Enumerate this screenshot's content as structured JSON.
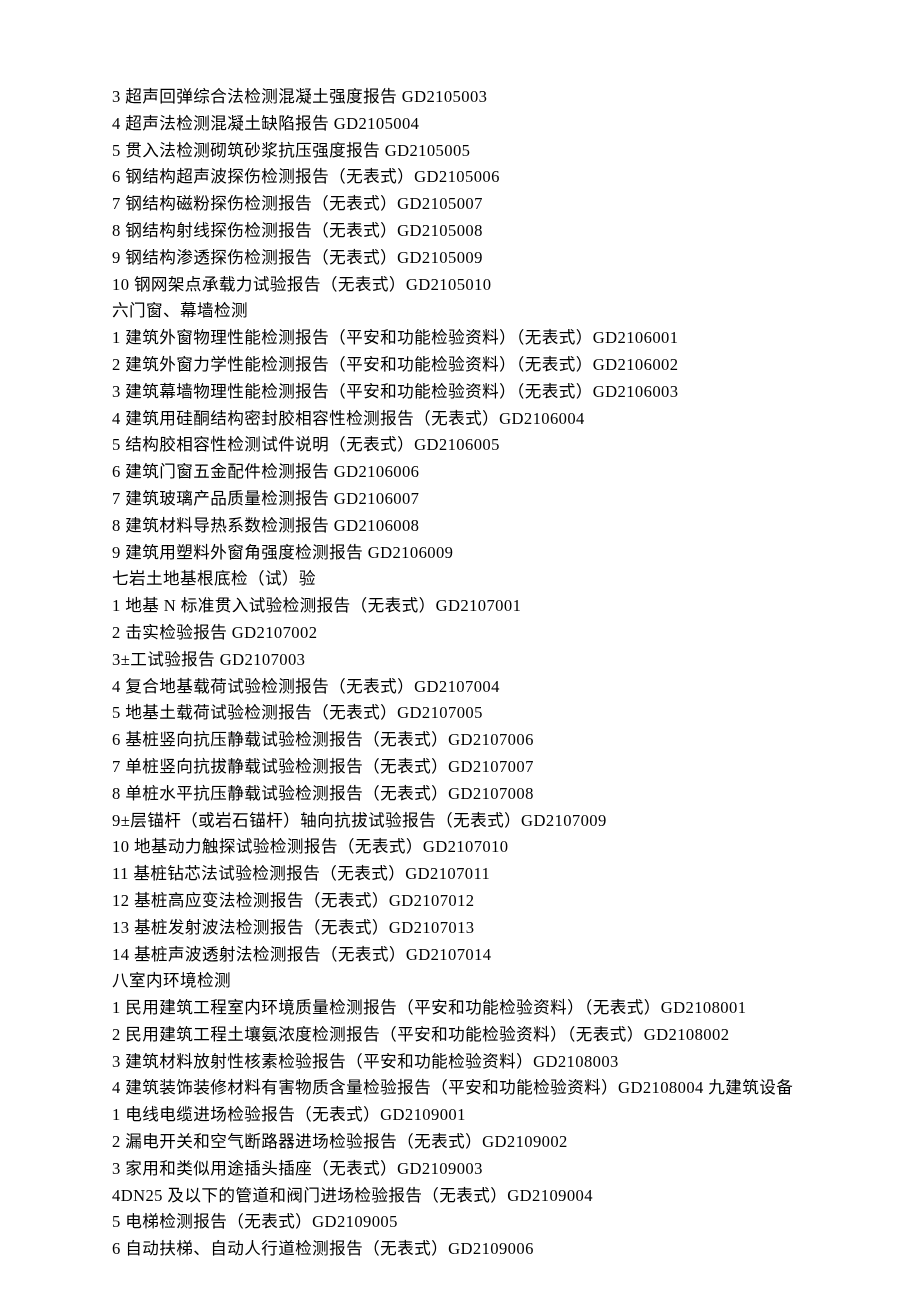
{
  "lines": [
    "3 超声回弹综合法检测混凝土强度报告 GD2105003",
    "4 超声法检测混凝土缺陷报告 GD2105004",
    "5 贯入法检测砌筑砂浆抗压强度报告 GD2105005",
    "6 钢结构超声波探伤检测报告（无表式）GD2105006",
    "7 钢结构磁粉探伤检测报告（无表式）GD2105007",
    "8 钢结构射线探伤检测报告（无表式）GD2105008",
    "9 钢结构渗透探伤检测报告（无表式）GD2105009",
    "10 钢网架点承载力试验报告（无表式）GD2105010",
    "六门窗、幕墙检测",
    "1 建筑外窗物理性能检测报告（平安和功能检验资料）（无表式）GD2106001",
    "2 建筑外窗力学性能检测报告（平安和功能检验资料）（无表式）GD2106002",
    "3 建筑幕墙物理性能检测报告（平安和功能检验资料）（无表式）GD2106003",
    "4 建筑用硅酮结构密封胶相容性检测报告（无表式）GD2106004",
    "5 结构胶相容性检测试件说明（无表式）GD2106005",
    "6 建筑门窗五金配件检测报告 GD2106006",
    "7 建筑玻璃产品质量检测报告 GD2106007",
    "8 建筑材料导热系数检测报告 GD2106008",
    "9 建筑用塑料外窗角强度检测报告 GD2106009",
    "七岩土地基根底检（试）验",
    "1 地基 N 标准贯入试验检测报告（无表式）GD2107001",
    "2 击实检验报告 GD2107002",
    "3±工试验报告 GD2107003",
    "4 复合地基载荷试验检测报告（无表式）GD2107004",
    "5 地基土载荷试验检测报告（无表式）GD2107005",
    "6 基桩竖向抗压静载试验检测报告（无表式）GD2107006",
    "7 单桩竖向抗拔静载试验检测报告（无表式）GD2107007",
    "8 单桩水平抗压静载试验检测报告（无表式）GD2107008",
    "9±层锚杆（或岩石锚杆）轴向抗拔试验报告（无表式）GD2107009",
    "10 地基动力触探试验检测报告（无表式）GD2107010",
    "11 基桩钻芯法试验检测报告（无表式）GD2107011",
    "12 基桩高应变法检测报告（无表式）GD2107012",
    "13 基桩发射波法检测报告（无表式）GD2107013",
    "14 基桩声波透射法检测报告（无表式）GD2107014",
    "八室内环境检测",
    "1 民用建筑工程室内环境质量检测报告（平安和功能检验资料）（无表式）GD2108001",
    "2 民用建筑工程土壤氨浓度检测报告（平安和功能检验资料）（无表式）GD2108002",
    "3 建筑材料放射性核素检验报告（平安和功能检验资料）GD2108003",
    "4 建筑装饰装修材料有害物质含量检验报告（平安和功能检验资料）GD2108004 九建筑设备",
    "1 电线电缆进场检验报告（无表式）GD2109001",
    "2 漏电开关和空气断路器进场检验报告（无表式）GD2109002",
    "3 家用和类似用途插头插座（无表式）GD2109003",
    "4DN25 及以下的管道和阀门进场检验报告（无表式）GD2109004",
    "5 电梯检测报告（无表式）GD2109005",
    "6 自动扶梯、自动人行道检测报告（无表式）GD2109006"
  ]
}
